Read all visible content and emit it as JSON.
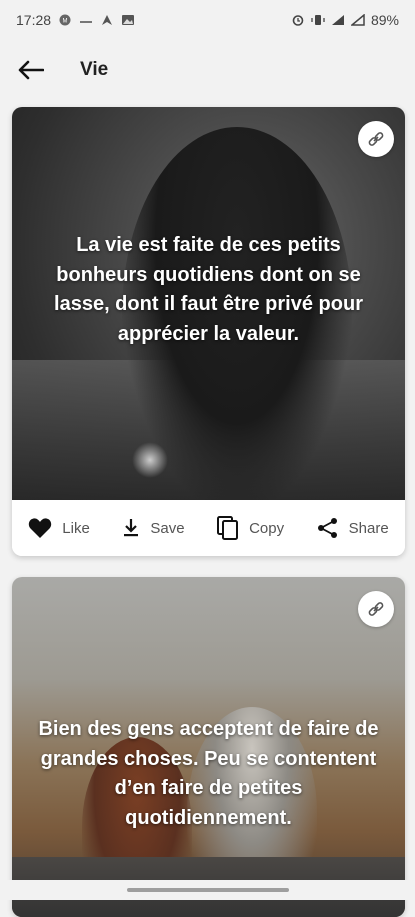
{
  "status_bar": {
    "time": "17:28",
    "battery": "89%",
    "left_icons": [
      "notification-icon",
      "signal-small-icon",
      "navigation-icon",
      "image-icon"
    ],
    "right_icons": [
      "alarm-icon",
      "vibrate-icon",
      "signal-icon",
      "signal-icon",
      "battery-icon"
    ]
  },
  "app_bar": {
    "title": "Vie",
    "back_icon": "arrow-back-icon"
  },
  "cards": [
    {
      "quote": "La vie est faite de ces petits bonheurs quotidiens dont on se lasse, dont il faut être privé pour apprécier la valeur.",
      "share_icon": "link-icon",
      "actions": [
        {
          "label": "Like",
          "icon": "heart-icon"
        },
        {
          "label": "Save",
          "icon": "download-icon"
        },
        {
          "label": "Copy",
          "icon": "copy-icon"
        },
        {
          "label": "Share",
          "icon": "share-icon"
        }
      ]
    },
    {
      "quote": "Bien des gens acceptent de faire de grandes choses. Peu se contentent d’en faire de petites quotidiennement.",
      "share_icon": "link-icon"
    }
  ],
  "colors": {
    "background": "#f2f2f2",
    "card": "#ffffff",
    "text_dark": "#222222",
    "action_text": "#555555"
  }
}
